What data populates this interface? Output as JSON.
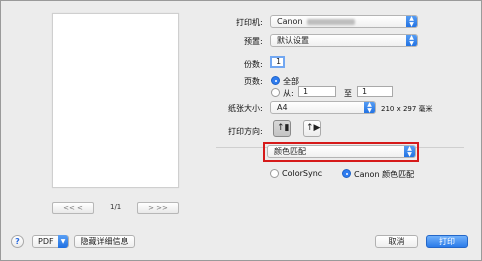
{
  "preview": {
    "prev_label": "<<  <",
    "next_label": ">  >>",
    "page_counter": "1/1"
  },
  "printer": {
    "label": "打印机:",
    "value": "Canon"
  },
  "presets": {
    "label": "预置:",
    "value": "默认设置"
  },
  "copies": {
    "label": "份数:",
    "value": "1"
  },
  "pages": {
    "label": "页数:",
    "all_label": "全部",
    "from_label": "从:",
    "from_value": "1",
    "to_label": "至",
    "to_value": "1"
  },
  "paper_size": {
    "label": "纸张大小:",
    "value": "A4",
    "dims": "210 x 297 毫米"
  },
  "orientation": {
    "label": "打印方向:",
    "portrait_glyph": "↑▮",
    "landscape_glyph": "↑▶"
  },
  "section_menu": {
    "value": "颜色匹配"
  },
  "color_matching": {
    "option_colorsync": "ColorSync",
    "option_canon": "Canon 颜色匹配"
  },
  "footer": {
    "help_label": "?",
    "pdf_label": "PDF",
    "hide_details_label": "隐藏详细信息",
    "cancel_label": "取消",
    "print_label": "打印"
  },
  "colors": {
    "accent": "#2b7be9",
    "highlight": "#d61a1a"
  }
}
